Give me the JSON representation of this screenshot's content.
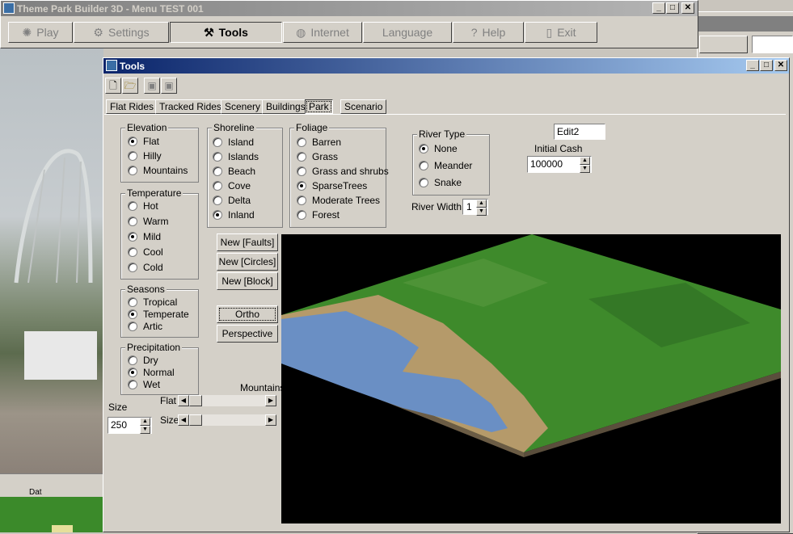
{
  "main_window": {
    "title": "Theme Park Builder 3D - Menu TEST 001",
    "menu": [
      {
        "label": "Play",
        "icon": "sun-icon"
      },
      {
        "label": "Settings",
        "icon": "gear-icon"
      },
      {
        "label": "Tools",
        "icon": "tools-icon"
      },
      {
        "label": "Internet",
        "icon": "globe-icon"
      },
      {
        "label": "Language",
        "icon": ""
      },
      {
        "label": "Help",
        "icon": "question-icon"
      },
      {
        "label": "Exit",
        "icon": "door-icon"
      }
    ],
    "background_text": "Dat"
  },
  "tools_window": {
    "title": "Tools",
    "toolbar": [
      "new-file-icon",
      "open-folder-icon",
      "save-icon",
      "save-as-icon"
    ],
    "tabs": [
      "Flat Rides",
      "Tracked Rides",
      "Scenery",
      "Buildings",
      "Park",
      "Scenario"
    ],
    "active_tab": "Park",
    "elevation": {
      "title": "Elevation",
      "options": [
        "Flat",
        "Hilly",
        "Mountains"
      ],
      "selected": "Flat"
    },
    "temperature": {
      "title": "Temperature",
      "options": [
        "Hot",
        "Warm",
        "Mild",
        "Cool",
        "Cold"
      ],
      "selected": "Mild"
    },
    "seasons": {
      "title": "Seasons",
      "options": [
        "Tropical",
        "Temperate",
        "Artic"
      ],
      "selected": "Temperate"
    },
    "precipitation": {
      "title": "Precipitation",
      "options": [
        "Dry",
        "Normal",
        "Wet"
      ],
      "selected": "Normal"
    },
    "shoreline": {
      "title": "Shoreline",
      "options": [
        "Island",
        "Islands",
        "Beach",
        "Cove",
        "Delta",
        "Inland"
      ],
      "selected": "Inland"
    },
    "foliage": {
      "title": "Foliage",
      "options": [
        "Barren",
        "Grass",
        "Grass and shrubs",
        "SparseTrees",
        "Moderate Trees",
        "Forest"
      ],
      "selected": "SparseTrees"
    },
    "river_type": {
      "title": "River Type",
      "options": [
        "None",
        "Meander",
        "Snake"
      ],
      "selected": "None"
    },
    "river_width": {
      "label": "River Width",
      "value": "1"
    },
    "edit2": "Edit2",
    "initial_cash": {
      "label": "Initial Cash",
      "value": "100000"
    },
    "buttons": {
      "faults": "New [Faults]",
      "circles": "New [Circles]",
      "block": "New [Block]",
      "ortho": "Ortho",
      "perspective": "Perspective"
    },
    "mountains_label": "Mountains",
    "flat_label": "Flat",
    "size_scroll_label": "Size",
    "size": {
      "label": "Size",
      "value": "250"
    }
  }
}
